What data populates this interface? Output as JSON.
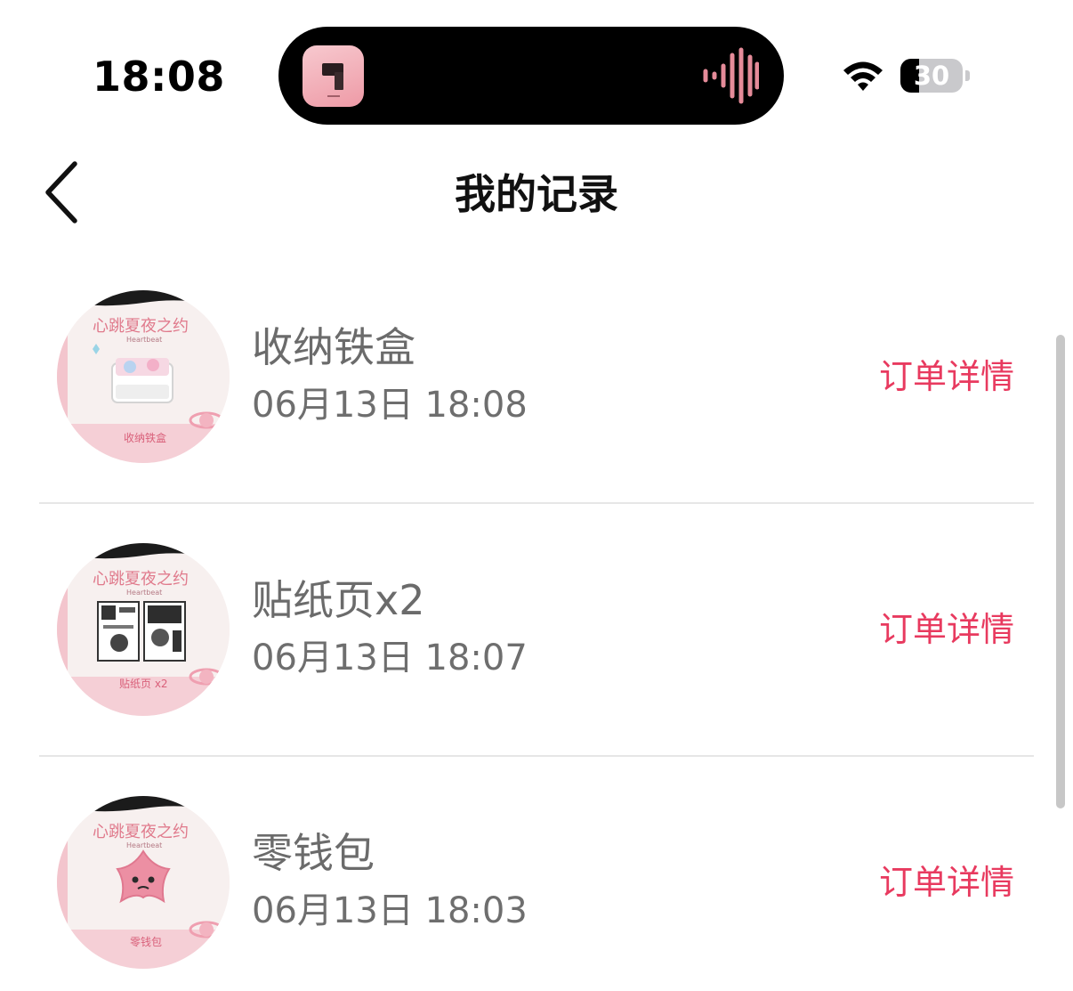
{
  "status_bar": {
    "time": "18:08",
    "battery_level": "30",
    "wifi_icon": "wifi-icon",
    "island_app_icon": "pink-box-app-icon",
    "island_activity_icon": "audio-waveform-icon"
  },
  "nav": {
    "back_icon": "chevron-left-icon",
    "title": "我的记录"
  },
  "records": [
    {
      "name": "收纳铁盒",
      "time": "06月13日 18:08",
      "action": "订单详情",
      "thumbnail": "tin-box-thumbnail"
    },
    {
      "name": "贴纸页x2",
      "time": "06月13日 18:07",
      "action": "订单详情",
      "thumbnail": "sticker-sheet-thumbnail"
    },
    {
      "name": "零钱包",
      "time": "06月13日 18:03",
      "action": "订单详情",
      "thumbnail": "coin-purse-thumbnail"
    }
  ],
  "colors": {
    "accent": "#e83a5f",
    "text_secondary": "#6b6b6b",
    "divider": "#e6e6e6",
    "thumb_pink": "#f4c6cf"
  }
}
